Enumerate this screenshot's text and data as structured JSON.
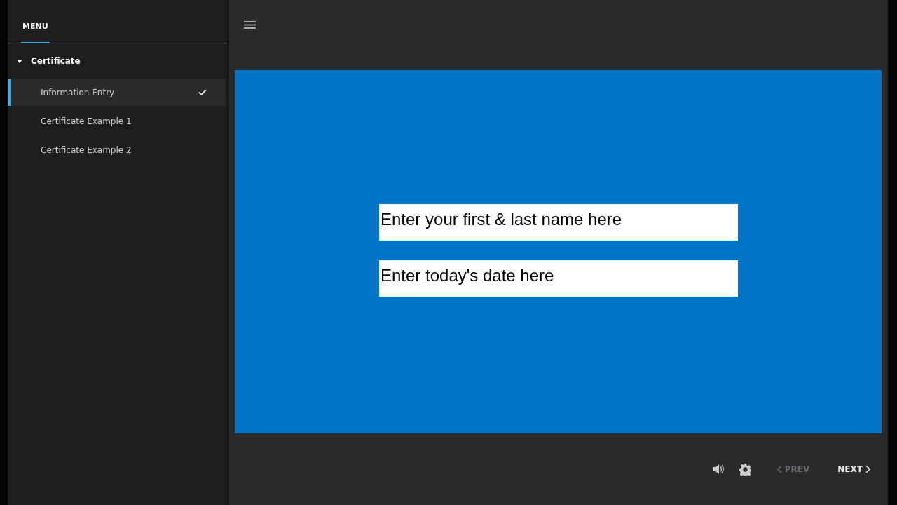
{
  "sidebar": {
    "tab": "MENU",
    "section": {
      "title": "Certificate",
      "expanded": true,
      "items": [
        {
          "label": "Information Entry",
          "selected": true,
          "checked": true
        },
        {
          "label": "Certificate Example 1",
          "selected": false,
          "checked": false
        },
        {
          "label": "Certificate Example 2",
          "selected": false,
          "checked": false
        }
      ]
    }
  },
  "slide": {
    "fields": [
      {
        "placeholder": "Enter your first & last name here"
      },
      {
        "placeholder": "Enter today's date here"
      }
    ]
  },
  "controls": {
    "prev": {
      "label": "PREV",
      "disabled": true
    },
    "next": {
      "label": "NEXT",
      "disabled": false
    }
  }
}
